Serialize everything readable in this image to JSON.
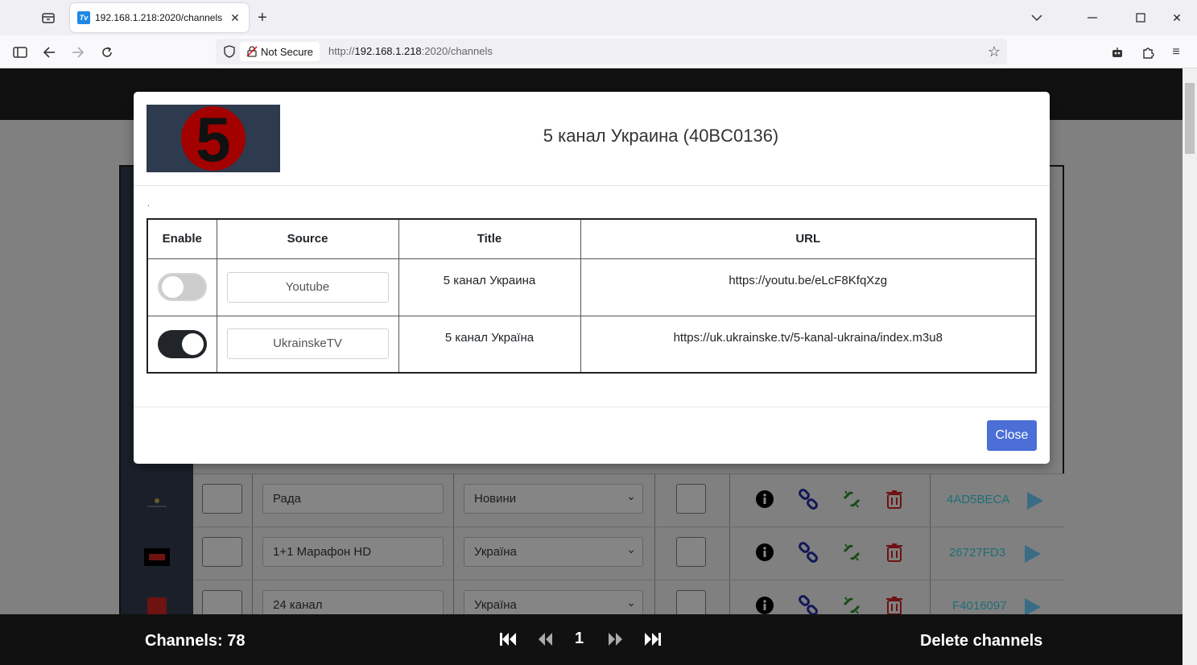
{
  "browser": {
    "tab_title": "192.168.1.218:2020/channels",
    "tab_favicon_text": "Tv",
    "security_label": "Not Secure",
    "url_prefix": "http://",
    "url_host": "192.168.1.218",
    "url_path": ":2020/channels"
  },
  "background_rows": [
    {
      "name": "Рада",
      "category": "Новини",
      "id": "4AD5BECA"
    },
    {
      "name": "1+1 Марафон HD",
      "category": "Україна",
      "id": "26727FD3"
    },
    {
      "name": "24 канал",
      "category": "Україна",
      "id": "F4016097"
    }
  ],
  "footer": {
    "channels_count": "Channels: 78",
    "page_number": "1",
    "delete_label": "Delete channels"
  },
  "modal": {
    "logo_number": "5",
    "title": "5 канал Украина (40BC0136)",
    "dot": ".",
    "headers": {
      "enable": "Enable",
      "source": "Source",
      "title": "Title",
      "url": "URL"
    },
    "sources": [
      {
        "enabled": false,
        "source": "Youtube",
        "title": "5 канал Украина",
        "url": "https://youtu.be/eLcF8KfqXzg"
      },
      {
        "enabled": true,
        "source": "UkrainskeTV",
        "title": "5 канал Україна",
        "url": "https://uk.ukrainske.tv/5-kanal-ukraina/index.m3u8"
      }
    ],
    "close_label": "Close"
  },
  "colors": {
    "accent": "#4b6fd6",
    "toggle_on": "#212529",
    "toggle_off": "#cccccc",
    "link_icon": "#1a2bd6",
    "unlink_icon": "#2e9e2e",
    "delete_icon": "#e02424",
    "hex_id": "#3fb8c6"
  }
}
